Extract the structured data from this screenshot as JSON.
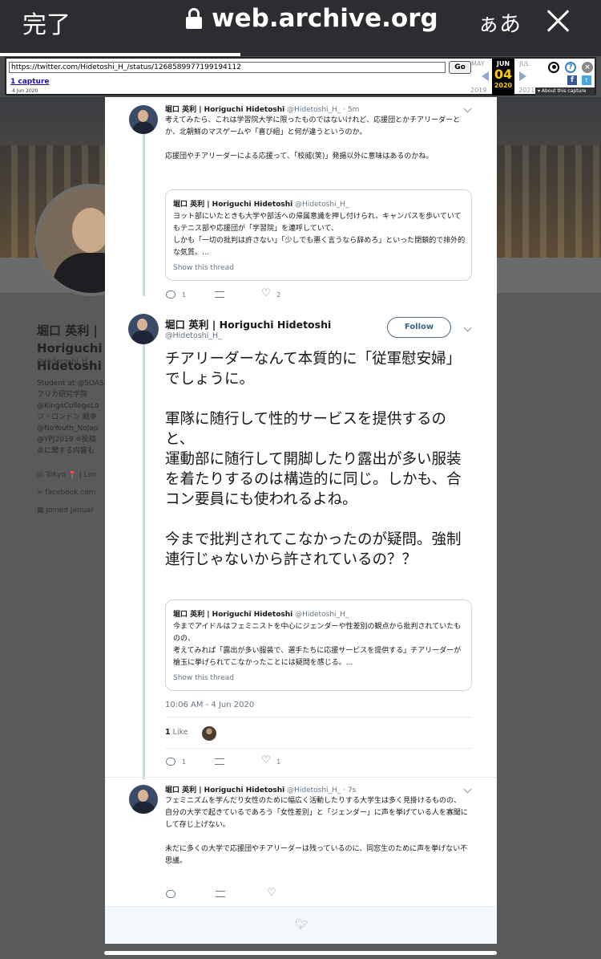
{
  "safari": {
    "done_label": "完了",
    "domain": "web.archive.org",
    "text_size_label": "ぁあ"
  },
  "wayback": {
    "url_value": "https://twitter.com/Hidetoshi_H_/status/1268589977199194112",
    "go_label": "Go",
    "captures_label": "1 capture",
    "capture_date": "4 Jun 2020",
    "prev_month": "MAY",
    "current_month": "JUN",
    "next_month": "JUL",
    "current_day": "04",
    "prev_year": "2019",
    "current_year": "2020",
    "next_year": "2021",
    "about_label": "About this capture"
  },
  "profile_bg": {
    "name": "堀口 英利 | Horiguchi Hidetoshi",
    "handle": "@Hidetoshi_H_",
    "bio_lines": [
      "Student at @SOAS",
      "フリカ研究学院",
      "@KingsCollegeLo",
      "ジ・ロンドン 戦争",
      "@NoYouth_NoJap",
      "@YPJ2019 ※投稿",
      "炎に関する内容も"
    ],
    "location": "Tokyo 📍 | Lon",
    "website": "facebook.com",
    "joined": "Joined Januar"
  },
  "tweets": {
    "prev": {
      "name": "堀口 英利 | Horiguchi Hidetoshi",
      "handle": "@Hidetoshi_H_",
      "time": "5m",
      "text": "考えてみたら、これは学習院大学に限ったものではないけれど、応援団とかチアリーダーとか、北朝鮮のマスゲームや「喜び組」と何が違うというのか。\n\n応援団やチアリーダーによる応援って、「校威(笑)」発揚以外に意味はあるのかね。",
      "quote": {
        "name": "堀口 英利 | Horiguchi Hidetoshi",
        "handle": "@Hidetoshi_H_",
        "text": "ヨット部にいたときも大学や部活への帰属意識を押し付けられ、キャンパスを歩いていてもテニス部や応援団が「学習院」を連呼していて、\nしかも「一切の批判は許さない」「少しでも悪く言うなら辞めろ」といった閉鎖的で排外的な気質。...",
        "show_thread": "Show this thread"
      },
      "replies": "1",
      "retweets": "",
      "likes": "2"
    },
    "main": {
      "name": "堀口 英利 | Horiguchi Hidetoshi",
      "handle": "@Hidetoshi_H_",
      "follow_label": "Follow",
      "text": "チアリーダーなんて本質的に「従軍慰安婦」でしょうに。\n\n軍隊に随行して性的サービスを提供するのと、\n運動部に随行して開脚したり露出が多い服装を着たりするのは構造的に同じ。しかも、合コン要員にも使われるよね。\n\n今まで批判されてこなかったのが疑問。強制連行じゃないから許されているの？？",
      "quote": {
        "name": "堀口 英利 | Horiguchi Hidetoshi",
        "handle": "@Hidetoshi_H_",
        "text": "今までアイドルはフェミニストを中心にジェンダーや性差別の観点から批判されていたものの、\n考えてみれば「露出が多い服装で、選手たちに応援サービスを提供する」チアリーダーが槍玉に挙げられてこなかったことには疑問を感じる。...",
        "show_thread": "Show this thread"
      },
      "timestamp": "10:06 AM - 4 Jun 2020",
      "like_count": "1",
      "like_label": "Like",
      "replies": "1",
      "retweets": "",
      "likes": "1"
    },
    "next": {
      "name": "堀口 英利 | Horiguchi Hidetoshi",
      "handle": "@Hidetoshi_H_",
      "time": "7s",
      "text": "フェミニズムを学んだり女性のために幅広く活動したりする大学生は多く見掛けるものの、\n自分の大学で起きているであろう「女性差別」と「ジェンダー」に声を挙げている人を寡聞にして存じ上げない。\n\n未だに多くの大学で応援団やチアリーダーは残っているのに、同窓生のために声を挙げない不思議。"
    }
  }
}
